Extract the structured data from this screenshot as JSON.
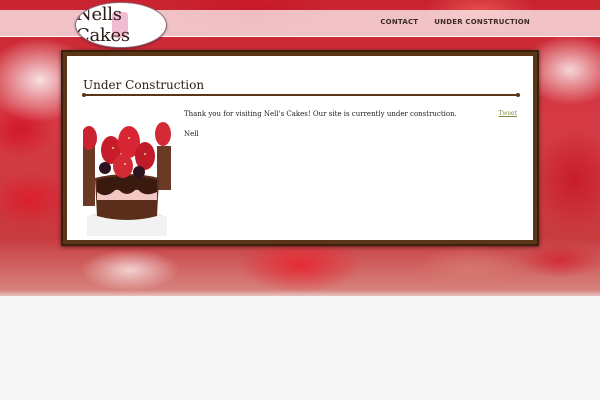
{
  "header": {
    "logo_text": "Nells Cakes",
    "nav": [
      {
        "label": "CONTACT"
      },
      {
        "label": "UNDER CONSTRUCTION"
      }
    ]
  },
  "content": {
    "title": "Under Construction",
    "intro": "Thank you for visiting Nell's Cakes! Our site is currently under construction.",
    "signature": "Nell",
    "tweet_label": "Tweet"
  },
  "colors": {
    "frame_brown": "#5a3516",
    "tweet_link": "#7c8a3b",
    "strawberry_red": "#d32a36"
  },
  "icons": {
    "logo": "cake-logo-icon"
  }
}
